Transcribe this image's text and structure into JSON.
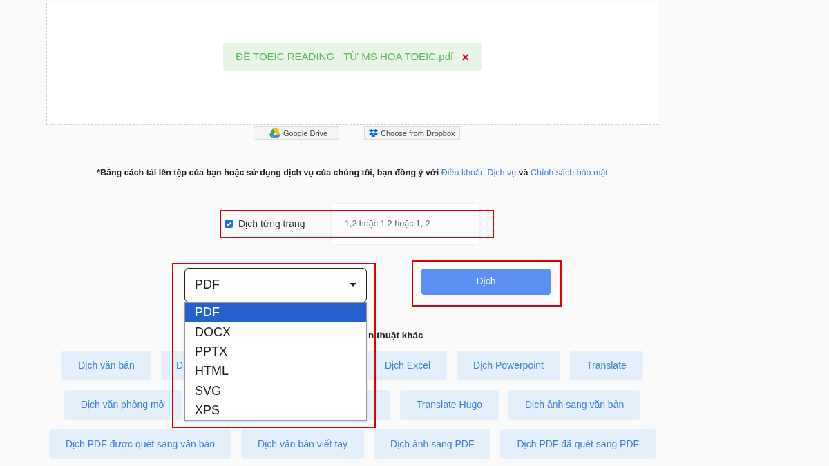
{
  "upload": {
    "file_name": "ĐỀ TOEIC READING - TỪ MS HOA TOEIC.pdf",
    "remove": "×"
  },
  "sources": [
    {
      "kind": "drive",
      "label": "Google Drive"
    },
    {
      "kind": "dropbox",
      "label": "Choose from Dropbox"
    }
  ],
  "terms": {
    "text": "*Bằng cách tải lên tệp của bạn hoặc sử dụng dịch vụ của chúng tôi, bạn đồng ý với",
    "link_1": "Điều khoản Dịch vụ",
    "joiner": "và",
    "link_2": "Chính sách bảo mật"
  },
  "page_option": {
    "checked": true,
    "label": "Dịch từng trang",
    "placeholder": "1,2 hoặc 1 2 hoặc 1, 2",
    "highlighted": true
  },
  "format": {
    "value": "PDF",
    "expanded": true,
    "highlighted": true,
    "options": [
      {
        "label": "PDF",
        "selected": true
      },
      {
        "label": "DOCX",
        "selected": false
      },
      {
        "label": "PPTX",
        "selected": false
      },
      {
        "label": "HTML",
        "selected": false
      },
      {
        "label": "SVG",
        "selected": false
      },
      {
        "label": "XPS",
        "selected": false
      }
    ]
  },
  "translate_button": {
    "label": "Dịch",
    "highlighted": true
  },
  "other_tools": {
    "heading": "n thuật khác",
    "lines": [
      {
        "links": [
          {
            "kind": "chip",
            "label": "Dịch văn bản"
          },
          {
            "kind": "covered",
            "label": "D"
          },
          {
            "kind": "chip",
            "label": "Dịch Excel"
          },
          {
            "kind": "chip",
            "label": "Dịch Powerpoint"
          },
          {
            "kind": "chip",
            "label": "Translate"
          }
        ]
      },
      {
        "links": [
          {
            "kind": "chip",
            "label": "Dịch văn phòng mở"
          },
          {
            "kind": "covered"
          },
          {
            "kind": "chip",
            "label": "Translate Hugo"
          },
          {
            "kind": "chip",
            "label": "Dịch ảnh sang văn bản"
          }
        ]
      },
      {
        "links": [
          {
            "kind": "chip",
            "label": "Dịch PDF được quét sang văn bản"
          },
          {
            "kind": "chip",
            "label": "Dịch văn bản viết tay"
          },
          {
            "kind": "chip",
            "label": "Dịch ảnh sang PDF"
          },
          {
            "kind": "chip",
            "label": "Dịch PDF đã quét sang PDF"
          }
        ]
      }
    ]
  }
}
